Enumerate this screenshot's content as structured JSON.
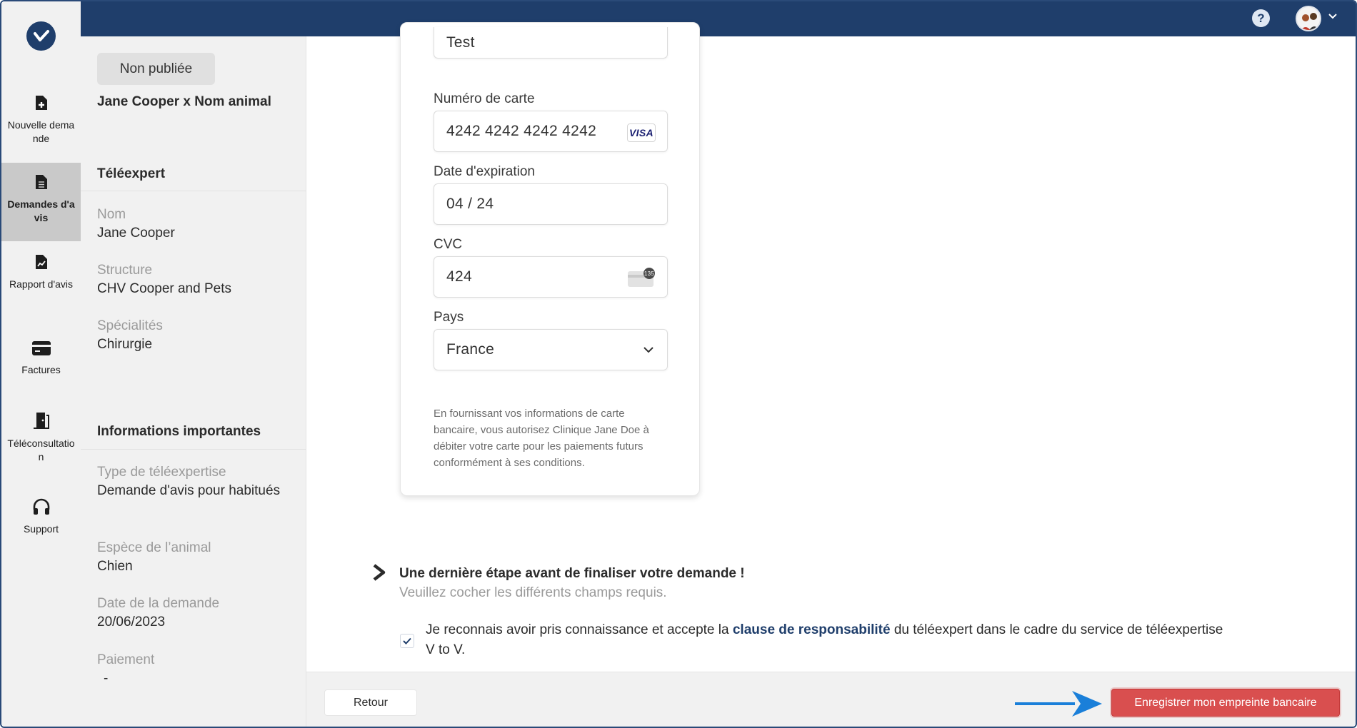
{
  "nav": {
    "items": [
      {
        "label": "Nouvelle demande",
        "icon": "file-plus-icon"
      },
      {
        "label": "Demandes d'avis",
        "icon": "document-icon",
        "active": true
      },
      {
        "label": "Rapport d'avis",
        "icon": "report-icon"
      },
      {
        "label": "Factures",
        "icon": "credit-card-icon"
      },
      {
        "label": "Téléconsultation",
        "icon": "door-exit-icon"
      },
      {
        "label": "Support",
        "icon": "headphones-icon"
      }
    ]
  },
  "header": {
    "help": "?"
  },
  "info": {
    "status_badge": "Non publiée",
    "case_title": "Jane Cooper x Nom animal",
    "teleexpert": {
      "heading": "Téléexpert",
      "name_label": "Nom",
      "name_value": "Jane Cooper",
      "structure_label": "Structure",
      "structure_value": "CHV Cooper and Pets",
      "specialties_label": "Spécialités",
      "specialties_value": "Chirurgie"
    },
    "important": {
      "heading": "Informations importantes",
      "type_label": "Type de téléexpertise",
      "type_value": "Demande d'avis pour habitués",
      "species_label": "Espèce de l’animal",
      "species_value": "Chien",
      "date_label": "Date de la demande",
      "date_value": "20/06/2023",
      "payment_label": "Paiement",
      "payment_value": "-"
    }
  },
  "payment_form": {
    "name_value": "Test",
    "card_number_label": "Numéro de carte",
    "card_number_value": "4242 4242 4242 4242",
    "card_brand": "VISA",
    "expiry_label": "Date d'expiration",
    "expiry_value": "04 / 24",
    "cvc_label": "CVC",
    "cvc_value": "424",
    "cvc_icon_badge": "135",
    "country_label": "Pays",
    "country_value": "France",
    "disclaimer": "En fournissant vos informations de carte bancaire, vous autorisez Clinique Jane Doe à débiter votre carte pour les paiements futurs conformément à ses conditions."
  },
  "final_step": {
    "title": "Une dernière étape avant de finaliser votre demande !",
    "subtitle": "Veuillez cocher les différents champs requis.",
    "consent_before": "Je reconnais avoir pris connaissance et accepte la ",
    "consent_link": "clause de responsabilité",
    "consent_after": " du téléexpert dans le cadre du service de téléexpertise V to V.",
    "checked": true
  },
  "footer": {
    "back_label": "Retour",
    "save_label": "Enregistrer mon empreinte bancaire"
  },
  "colors": {
    "brand_navy": "#1f3e6b",
    "save_button": "#d94f4f",
    "annotation_arrow": "#1a7fd9"
  }
}
